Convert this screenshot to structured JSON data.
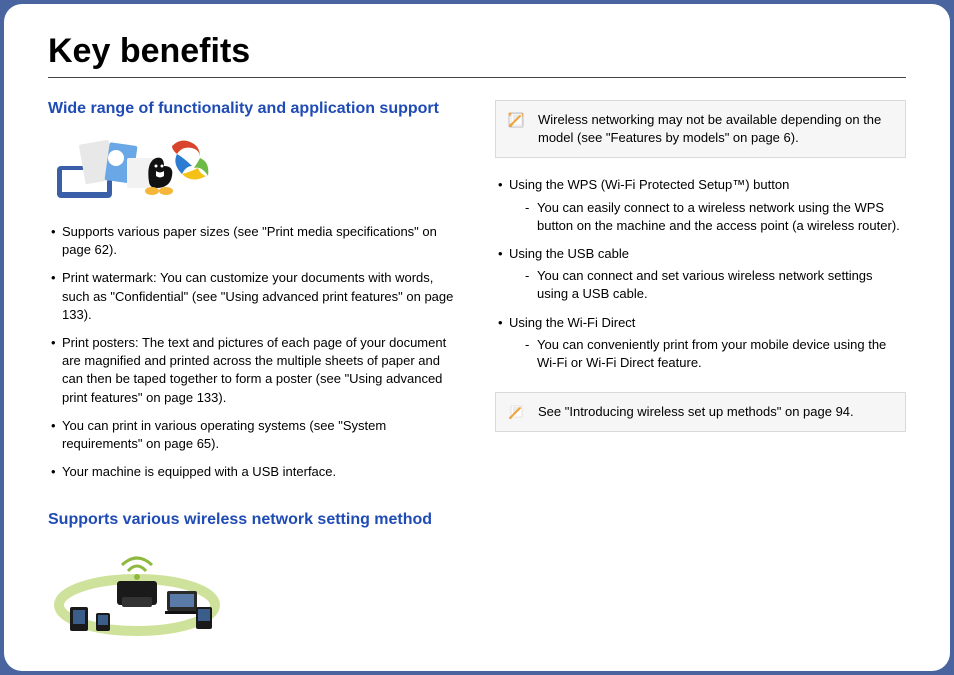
{
  "title": "Key benefits",
  "left": {
    "h2a": "Wide range of functionality and application support",
    "bullets_a": [
      "Supports various paper sizes (see \"Print media specifications\" on page 62).",
      "Print watermark: You can customize your documents with words, such as \"Confidential\" (see \"Using advanced print features\" on page 133).",
      "Print posters: The text and pictures of each page of your document are magnified and printed across the multiple sheets of paper and can then be taped together to form a poster (see \"Using advanced print features\" on page 133).",
      "You can print in various operating systems (see \"System requirements\" on page 65).",
      "Your machine is equipped with a USB interface."
    ],
    "h2b": "Supports various wireless network setting method"
  },
  "right": {
    "note1": "Wireless networking may not be available depending on the model (see \"Features by models\" on page 6).",
    "items": [
      {
        "title": "Using the WPS (Wi-Fi Protected Setup™) button",
        "sub": "You can easily connect to a wireless network using the WPS button on the machine and the access point (a wireless router)."
      },
      {
        "title": "Using the USB cable",
        "sub": "You can connect and set various wireless network settings using a USB cable."
      },
      {
        "title": "Using the Wi-Fi Direct",
        "sub": "You can conveniently print from your mobile device using the Wi-Fi or Wi-Fi Direct feature."
      }
    ],
    "note2": "See \"Introducing wireless set up methods\" on page 94."
  }
}
